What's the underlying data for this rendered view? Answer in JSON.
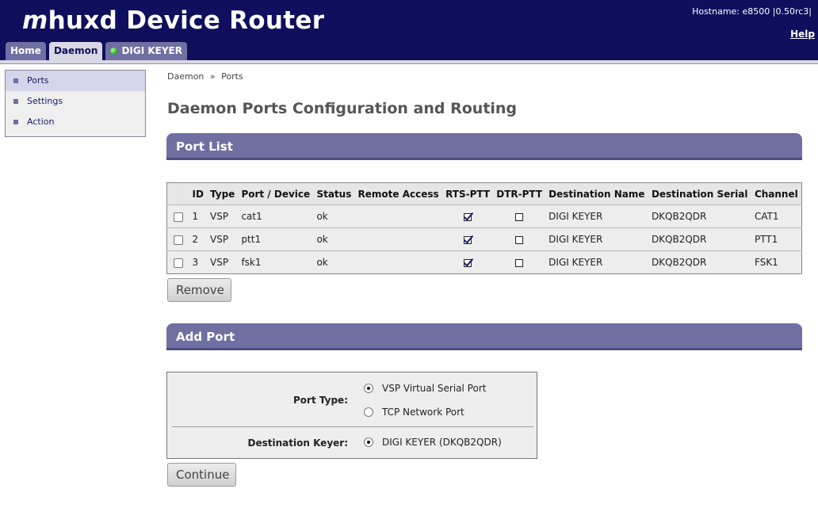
{
  "header": {
    "title_prefix": "m",
    "title_rest": "huxd Device Router",
    "hostname": "Hostname: e8500 |0.50rc3|",
    "help": "Help"
  },
  "tabs": [
    {
      "label": "Home",
      "active": false
    },
    {
      "label": "Daemon",
      "active": true
    },
    {
      "label": "DIGI KEYER",
      "active": false,
      "status_led": "green"
    }
  ],
  "sidebar": {
    "items": [
      {
        "label": "Ports",
        "active": true
      },
      {
        "label": "Settings",
        "active": false
      },
      {
        "label": "Action",
        "active": false
      }
    ]
  },
  "breadcrumb": {
    "items": [
      "Daemon",
      "»",
      "Ports"
    ]
  },
  "page_title": "Daemon Ports Configuration and Routing",
  "port_list": {
    "section_title": "Port List",
    "columns": [
      "",
      "ID",
      "Type",
      "Port / Device",
      "Status",
      "Remote Access",
      "RTS-PTT",
      "DTR-PTT",
      "Destination Name",
      "Destination Serial",
      "Channel"
    ],
    "rows": [
      {
        "selected": false,
        "id": "1",
        "type": "VSP",
        "device": "cat1",
        "status": "ok",
        "remote_access": "",
        "rts_ptt": true,
        "dtr_ptt": false,
        "dest_name": "DIGI KEYER",
        "dest_serial": "DKQB2QDR",
        "channel": "CAT1"
      },
      {
        "selected": false,
        "id": "2",
        "type": "VSP",
        "device": "ptt1",
        "status": "ok",
        "remote_access": "",
        "rts_ptt": true,
        "dtr_ptt": false,
        "dest_name": "DIGI KEYER",
        "dest_serial": "DKQB2QDR",
        "channel": "PTT1"
      },
      {
        "selected": false,
        "id": "3",
        "type": "VSP",
        "device": "fsk1",
        "status": "ok",
        "remote_access": "",
        "rts_ptt": true,
        "dtr_ptt": false,
        "dest_name": "DIGI KEYER",
        "dest_serial": "DKQB2QDR",
        "channel": "FSK1"
      }
    ],
    "remove_label": "Remove"
  },
  "add_port": {
    "section_title": "Add Port",
    "port_type_label": "Port Type:",
    "port_type_options": [
      {
        "label": "VSP Virtual Serial Port",
        "selected": true
      },
      {
        "label": "TCP Network Port",
        "selected": false
      }
    ],
    "dest_keyer_label": "Destination Keyer:",
    "dest_keyer_options": [
      {
        "label": "DIGI KEYER (DKQB2QDR)",
        "selected": true
      }
    ],
    "continue_label": "Continue"
  },
  "colors": {
    "header_bg": "#0f0f5e",
    "tab_bg": "#6f6fa2",
    "tab_active_bg": "#d8d8e4",
    "section_bar": "#6f6fa2",
    "led": "#2db82d"
  }
}
